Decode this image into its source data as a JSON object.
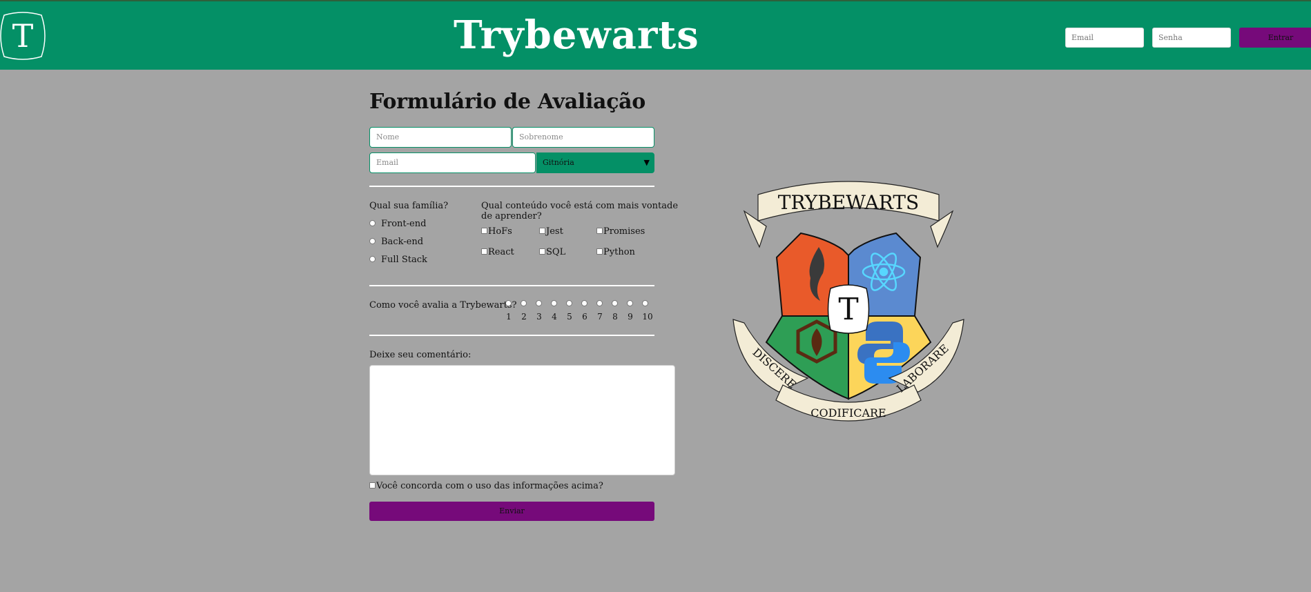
{
  "header": {
    "logo_letter": "T",
    "title": "Trybewarts",
    "email_placeholder": "Email",
    "password_placeholder": "Senha",
    "login_button": "Entrar"
  },
  "form": {
    "title": "Formulário de Avaliação",
    "name_placeholder": "Nome",
    "lastname_placeholder": "Sobrenome",
    "email_placeholder": "Email",
    "house_selected": "Gitnória",
    "family_question": "Qual sua família?",
    "families": [
      "Front-end",
      "Back-end",
      "Full Stack"
    ],
    "content_question_line1": "Qual conteúdo você está com mais vontade",
    "content_question_line2": "de aprender?",
    "contents": [
      "HoFs",
      "Jest",
      "Promises",
      "React",
      "SQL",
      "Python"
    ],
    "rating_question": "Como você avalia a Trybewarts?",
    "ratings": [
      "1",
      "2",
      "3",
      "4",
      "5",
      "6",
      "7",
      "8",
      "9",
      "10"
    ],
    "comment_label": "Deixe seu comentário:",
    "agreement_label": "Você concorda com o uso das informações acima?",
    "submit_button": "Enviar"
  },
  "crest": {
    "banner_top": "TRYBEWARTS",
    "banner_left": "DISCERE",
    "banner_bottom": "CODIFICARE",
    "banner_right": "LABORARE",
    "center_letter": "T",
    "colors": {
      "red": "#e95a2a",
      "blue": "#5b8ad0",
      "green": "#2e9e55",
      "yellow": "#fcd55a",
      "ribbon": "#f3ecd6"
    }
  },
  "colors": {
    "header": "#049066",
    "background": "#a4a4a4",
    "accent_purple": "#760a7a"
  }
}
